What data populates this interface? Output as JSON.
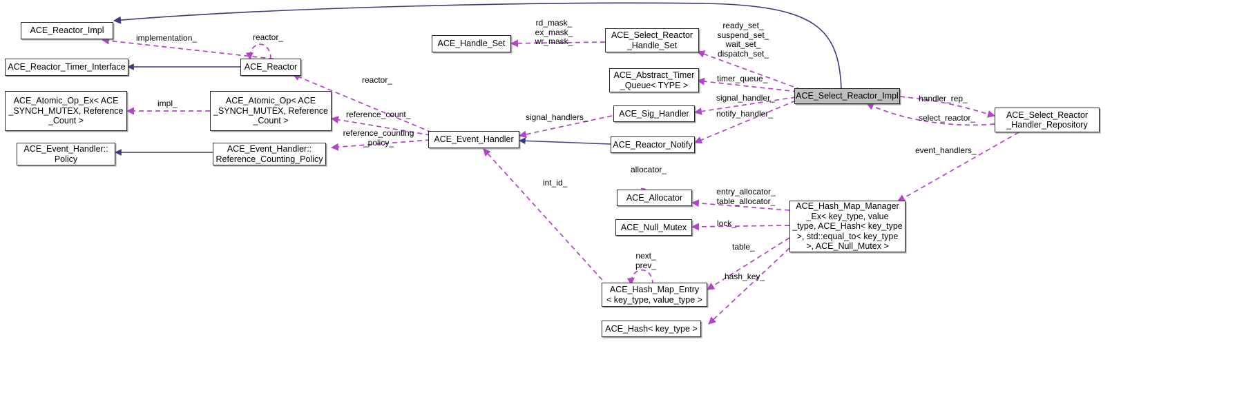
{
  "diagram": {
    "kind": "collaboration-diagram",
    "focus_class": "ACE_Select_Reactor_Impl",
    "colors": {
      "inheritance_edge": "#3b3b7a",
      "usage_edge": "#b144c8",
      "node_border": "#2b2b2b",
      "node_fill": "#ffffff",
      "focus_fill": "#bfbfbf",
      "text": "#000000",
      "background": "#ffffff"
    }
  },
  "nodes": [
    {
      "id": "reactor_impl",
      "label": "ACE_Reactor_Impl"
    },
    {
      "id": "reactor_timer_iface",
      "label": "ACE_Reactor_Timer_Interface"
    },
    {
      "id": "reactor",
      "label": "ACE_Reactor"
    },
    {
      "id": "atomic_op_ex",
      "label": "ACE_Atomic_Op_Ex< ACE\n_SYNCH_MUTEX, Reference\n_Count >"
    },
    {
      "id": "atomic_op",
      "label": "ACE_Atomic_Op< ACE\n_SYNCH_MUTEX, Reference\n_Count >"
    },
    {
      "id": "eh_policy",
      "label": "ACE_Event_Handler::\nPolicy"
    },
    {
      "id": "eh_ref_counting_policy",
      "label": "ACE_Event_Handler::\nReference_Counting_Policy"
    },
    {
      "id": "event_handler",
      "label": "ACE_Event_Handler"
    },
    {
      "id": "handle_set",
      "label": "ACE_Handle_Set"
    },
    {
      "id": "select_reactor_hs",
      "label": "ACE_Select_Reactor\n_Handle_Set"
    },
    {
      "id": "abstract_timer_queue",
      "label": "ACE_Abstract_Timer\n_Queue< TYPE >"
    },
    {
      "id": "sig_handler",
      "label": "ACE_Sig_Handler"
    },
    {
      "id": "reactor_notify",
      "label": "ACE_Reactor_Notify"
    },
    {
      "id": "select_reactor_impl",
      "label": "ACE_Select_Reactor_Impl",
      "highlight": true
    },
    {
      "id": "handler_repository",
      "label": "ACE_Select_Reactor\n_Handler_Repository"
    },
    {
      "id": "allocator",
      "label": "ACE_Allocator"
    },
    {
      "id": "null_mutex",
      "label": "ACE_Null_Mutex"
    },
    {
      "id": "hash_map_manager",
      "label": "ACE_Hash_Map_Manager\n_Ex< key_type, value\n_type, ACE_Hash< key_type\n>, std::equal_to< key_type\n>, ACE_Null_Mutex >"
    },
    {
      "id": "hash_map_entry",
      "label": "ACE_Hash_Map_Entry\n< key_type, value_type >"
    },
    {
      "id": "hash_key_type",
      "label": "ACE_Hash< key_type >"
    }
  ],
  "edge_labels": [
    {
      "id": "implementation",
      "text": "implementation_"
    },
    {
      "id": "reactor_self",
      "text": "reactor_"
    },
    {
      "id": "impl",
      "text": "impl_"
    },
    {
      "id": "reactor_eh",
      "text": "reactor_"
    },
    {
      "id": "reference_count",
      "text": "reference_count_"
    },
    {
      "id": "ref_count_policy",
      "text": "reference_counting\n_policy_"
    },
    {
      "id": "masks",
      "text": "rd_mask_\nex_mask_\nwr_mask_"
    },
    {
      "id": "sets",
      "text": "ready_set_\nsuspend_set_\nwait_set_\ndispatch_set_"
    },
    {
      "id": "timer_queue",
      "text": "timer_queue_"
    },
    {
      "id": "signal_handler",
      "text": "signal_handler_"
    },
    {
      "id": "notify_handler",
      "text": "notify_handler_"
    },
    {
      "id": "signal_handlers",
      "text": "signal_handlers_"
    },
    {
      "id": "handler_rep",
      "text": "handler_rep_"
    },
    {
      "id": "select_reactor",
      "text": "select_reactor_"
    },
    {
      "id": "event_handlers",
      "text": "event_handlers_"
    },
    {
      "id": "allocator_self",
      "text": "allocator_"
    },
    {
      "id": "entry_table_allocator",
      "text": "entry_allocator_\ntable_allocator_"
    },
    {
      "id": "lock",
      "text": "lock_"
    },
    {
      "id": "table",
      "text": "table_"
    },
    {
      "id": "int_id",
      "text": "int_id_"
    },
    {
      "id": "next_prev",
      "text": "next_\nprev_"
    },
    {
      "id": "hash_key",
      "text": "hash_key_"
    }
  ]
}
